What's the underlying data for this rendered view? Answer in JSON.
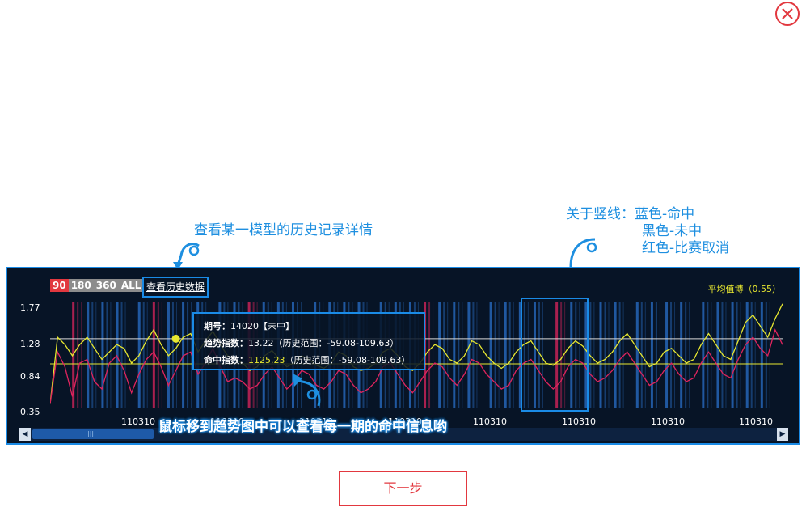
{
  "close": {
    "icon": "close-icon"
  },
  "callouts": {
    "history": "查看某一模型的历史记录详情",
    "vertical_lines": [
      "关于竖线：蓝色-命中",
      "黑色-未中",
      "红色-比赛取消"
    ],
    "mouse_hint": "鼠标移到趋势图中可以查看每一期的命中信息哟"
  },
  "chart_panel": {
    "ranges": [
      {
        "label": "90",
        "active": true
      },
      {
        "label": "180",
        "active": false
      },
      {
        "label": "360",
        "active": false
      },
      {
        "label": "ALL",
        "active": false
      }
    ],
    "history_link": "查看历史数据",
    "avg_label": "平均值博（0.55）",
    "tooltip": {
      "issue_label": "期号：",
      "issue_value": "14020【未中】",
      "trend_label": "趋势指数：",
      "trend_value": "13.22",
      "trend_range": "（历史范围：-59.08-109.63）",
      "hit_label": "命中指数：",
      "hit_value": "1125.23",
      "hit_range": "（历史范围：-59.08-109.63）"
    }
  },
  "chart_data": {
    "type": "line",
    "y_ticks": [
      "1.77",
      "1.28",
      "0.84",
      "0.35"
    ],
    "x_ticks": [
      "110310",
      "110310",
      "110310",
      "110310",
      "110310",
      "110310",
      "110310",
      "110310"
    ],
    "ylim": [
      0.35,
      1.77
    ],
    "reference_lines": [
      1.28,
      0.94
    ],
    "series": [
      {
        "color": "#e8e830",
        "values": [
          0.4,
          1.3,
          1.2,
          1.05,
          1.2,
          1.3,
          1.15,
          1.0,
          1.1,
          1.2,
          1.15,
          0.95,
          1.05,
          1.25,
          1.4,
          1.2,
          1.05,
          1.15,
          1.3,
          1.35,
          1.1,
          1.25,
          1.38,
          1.2,
          1.05,
          1.0,
          0.95,
          0.85,
          0.9,
          1.05,
          1.12,
          1.0,
          0.9,
          0.95,
          1.05,
          1.0,
          0.92,
          0.88,
          0.95,
          1.1,
          1.05,
          0.9,
          0.85,
          0.88,
          0.95,
          1.1,
          1.15,
          1.05,
          0.9,
          0.85,
          0.95,
          1.1,
          1.2,
          1.15,
          1.0,
          0.95,
          1.05,
          1.25,
          1.2,
          1.05,
          0.95,
          0.88,
          0.95,
          1.1,
          1.2,
          1.25,
          1.1,
          0.95,
          0.92,
          1.0,
          1.15,
          1.25,
          1.18,
          1.05,
          0.95,
          1.0,
          1.1,
          1.25,
          1.35,
          1.2,
          1.05,
          0.9,
          0.95,
          1.1,
          1.15,
          1.05,
          0.95,
          1.0,
          1.2,
          1.35,
          1.2,
          1.05,
          1.0,
          1.25,
          1.5,
          1.6,
          1.45,
          1.3,
          1.55,
          1.75
        ]
      },
      {
        "color": "#e0245e",
        "values": [
          0.4,
          1.1,
          0.9,
          0.5,
          0.95,
          1.0,
          0.7,
          0.6,
          0.95,
          1.05,
          0.85,
          0.55,
          0.8,
          1.0,
          1.1,
          0.9,
          0.65,
          0.85,
          1.05,
          1.1,
          0.8,
          0.95,
          1.15,
          0.9,
          0.7,
          0.75,
          0.7,
          0.6,
          0.65,
          0.8,
          0.9,
          0.75,
          0.6,
          0.7,
          0.85,
          0.8,
          0.65,
          0.6,
          0.7,
          0.85,
          0.8,
          0.65,
          0.55,
          0.6,
          0.7,
          0.9,
          0.95,
          0.8,
          0.65,
          0.55,
          0.7,
          0.85,
          0.95,
          0.9,
          0.75,
          0.65,
          0.8,
          1.0,
          0.95,
          0.8,
          0.7,
          0.6,
          0.65,
          0.85,
          0.95,
          1.0,
          0.85,
          0.7,
          0.6,
          0.7,
          0.9,
          1.0,
          0.95,
          0.8,
          0.7,
          0.75,
          0.85,
          1.0,
          1.1,
          0.95,
          0.8,
          0.65,
          0.7,
          0.85,
          0.95,
          0.8,
          0.7,
          0.75,
          0.95,
          1.1,
          0.95,
          0.8,
          0.75,
          1.0,
          1.2,
          1.3,
          1.15,
          1.05,
          1.4,
          1.2
        ]
      }
    ],
    "vertical_bars": [
      {
        "x": 0.03,
        "color": "#e0245e"
      },
      {
        "x": 0.05,
        "color": "#2a6fc9"
      },
      {
        "x": 0.07,
        "color": "#2a6fc9"
      },
      {
        "x": 0.09,
        "color": "#2a6fc9"
      },
      {
        "x": 0.12,
        "color": "#2a6fc9"
      },
      {
        "x": 0.14,
        "color": "#e0245e"
      },
      {
        "x": 0.16,
        "color": "#2a6fc9"
      },
      {
        "x": 0.18,
        "color": "#2a6fc9"
      },
      {
        "x": 0.2,
        "color": "#2a6fc9"
      },
      {
        "x": 0.23,
        "color": "#2a6fc9"
      },
      {
        "x": 0.25,
        "color": "#2a6fc9"
      },
      {
        "x": 0.27,
        "color": "#e0245e"
      },
      {
        "x": 0.29,
        "color": "#2a6fc9"
      },
      {
        "x": 0.31,
        "color": "#2a6fc9"
      },
      {
        "x": 0.33,
        "color": "#2a6fc9"
      },
      {
        "x": 0.36,
        "color": "#2a6fc9"
      },
      {
        "x": 0.38,
        "color": "#2a6fc9"
      },
      {
        "x": 0.4,
        "color": "#2a6fc9"
      },
      {
        "x": 0.42,
        "color": "#2a6fc9"
      },
      {
        "x": 0.45,
        "color": "#2a6fc9"
      },
      {
        "x": 0.47,
        "color": "#2a6fc9"
      },
      {
        "x": 0.49,
        "color": "#2a6fc9"
      },
      {
        "x": 0.51,
        "color": "#e0245e"
      },
      {
        "x": 0.53,
        "color": "#2a6fc9"
      },
      {
        "x": 0.55,
        "color": "#2a6fc9"
      },
      {
        "x": 0.57,
        "color": "#2a6fc9"
      },
      {
        "x": 0.6,
        "color": "#2a6fc9"
      },
      {
        "x": 0.62,
        "color": "#2a6fc9"
      },
      {
        "x": 0.64,
        "color": "#2a6fc9"
      },
      {
        "x": 0.66,
        "color": "#2a6fc9"
      },
      {
        "x": 0.69,
        "color": "#e0245e"
      },
      {
        "x": 0.71,
        "color": "#2a6fc9"
      },
      {
        "x": 0.73,
        "color": "#2a6fc9"
      },
      {
        "x": 0.75,
        "color": "#2a6fc9"
      },
      {
        "x": 0.77,
        "color": "#2a6fc9"
      },
      {
        "x": 0.8,
        "color": "#2a6fc9"
      },
      {
        "x": 0.82,
        "color": "#2a6fc9"
      },
      {
        "x": 0.84,
        "color": "#2a6fc9"
      },
      {
        "x": 0.86,
        "color": "#2a6fc9"
      },
      {
        "x": 0.89,
        "color": "#2a6fc9"
      },
      {
        "x": 0.91,
        "color": "#2a6fc9"
      },
      {
        "x": 0.93,
        "color": "#2a6fc9"
      },
      {
        "x": 0.95,
        "color": "#2a6fc9"
      },
      {
        "x": 0.97,
        "color": "#2a6fc9"
      }
    ]
  },
  "next_button": "下一步",
  "scrollbar": {
    "left_icon": "arrow-left-icon",
    "right_icon": "arrow-right-icon"
  }
}
